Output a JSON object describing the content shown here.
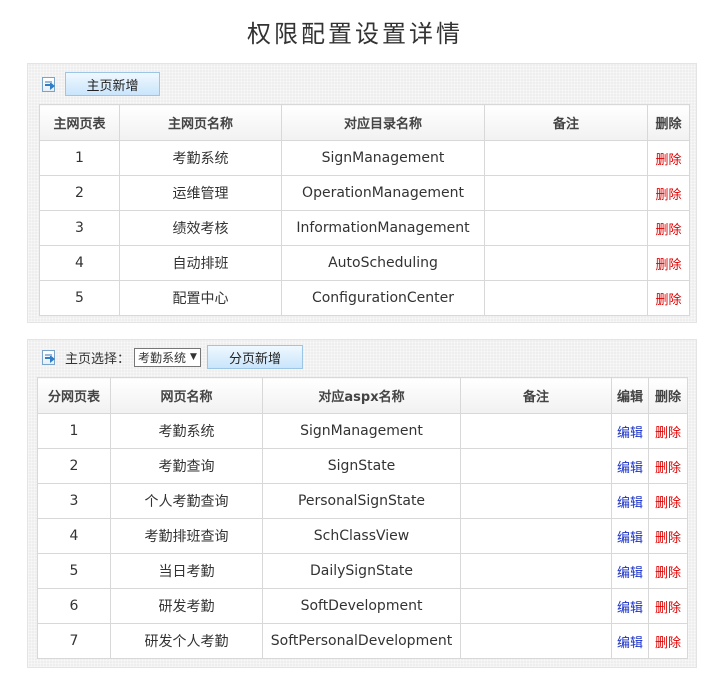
{
  "page_title": "权限配置设置详情",
  "main_section": {
    "add_button": "主页新增",
    "columns": [
      "主网页表",
      "主网页名称",
      "对应目录名称",
      "备注",
      "删除"
    ],
    "rows": [
      {
        "id": "1",
        "name": "考勤系统",
        "dir": "SignManagement",
        "note": "",
        "delete": "删除"
      },
      {
        "id": "2",
        "name": "运维管理",
        "dir": "OperationManagement",
        "note": "",
        "delete": "删除"
      },
      {
        "id": "3",
        "name": "绩效考核",
        "dir": "InformationManagement",
        "note": "",
        "delete": "删除"
      },
      {
        "id": "4",
        "name": "自动排班",
        "dir": "AutoScheduling",
        "note": "",
        "delete": "删除"
      },
      {
        "id": "5",
        "name": "配置中心",
        "dir": "ConfigurationCenter",
        "note": "",
        "delete": "删除"
      }
    ]
  },
  "sub_section": {
    "select_label": "主页选择：",
    "selected": "考勤系统",
    "add_button": "分页新增",
    "columns": [
      "分网页表",
      "网页名称",
      "对应aspx名称",
      "备注",
      "编辑",
      "删除"
    ],
    "rows": [
      {
        "id": "1",
        "name": "考勤系统",
        "aspx": "SignManagement",
        "note": "",
        "edit": "编辑",
        "delete": "删除"
      },
      {
        "id": "2",
        "name": "考勤查询",
        "aspx": "SignState",
        "note": "",
        "edit": "编辑",
        "delete": "删除"
      },
      {
        "id": "3",
        "name": "个人考勤查询",
        "aspx": "PersonalSignState",
        "note": "",
        "edit": "编辑",
        "delete": "删除"
      },
      {
        "id": "4",
        "name": "考勤排班查询",
        "aspx": "SchClassView",
        "note": "",
        "edit": "编辑",
        "delete": "删除"
      },
      {
        "id": "5",
        "name": "当日考勤",
        "aspx": "DailySignState",
        "note": "",
        "edit": "编辑",
        "delete": "删除"
      },
      {
        "id": "6",
        "name": "研发考勤",
        "aspx": "SoftDevelopment",
        "note": "",
        "edit": "编辑",
        "delete": "删除"
      },
      {
        "id": "7",
        "name": "研发个人考勤",
        "aspx": "SoftPersonalDevelopment",
        "note": "",
        "edit": "编辑",
        "delete": "删除"
      }
    ]
  },
  "colors": {
    "delete_link": "#e00000",
    "edit_link": "#1a32c8",
    "button_bg": "#c9e5fb"
  }
}
